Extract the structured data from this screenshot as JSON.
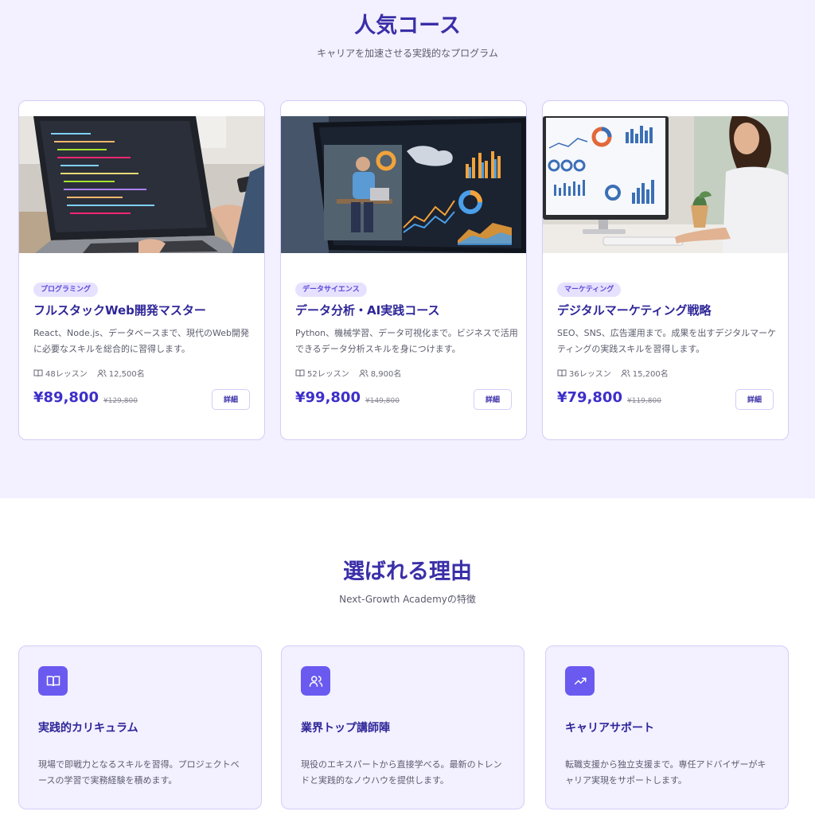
{
  "courses_section": {
    "title": "人気コース",
    "subtitle": "キャリアを加速させる実践的なプログラム",
    "courses": [
      {
        "tag": "プログラミング",
        "title": "フルスタックWeb開発マスター",
        "description": "React、Node.js、データベースまで、現代のWeb開発に必要なスキルを総合的に習得します。",
        "lessons": "48レッスン",
        "students": "12,500名",
        "price": "¥89,800",
        "old_price": "¥129,800",
        "detail_label": "詳細",
        "image_icon": "laptop-code-photo"
      },
      {
        "tag": "データサイエンス",
        "title": "データ分析・AI実践コース",
        "description": "Python、機械学習、データ可視化まで。ビジネスで活用できるデータ分析スキルを身につけます。",
        "lessons": "52レッスン",
        "students": "8,900名",
        "price": "¥99,800",
        "old_price": "¥149,800",
        "detail_label": "詳細",
        "image_icon": "data-dashboard-photo"
      },
      {
        "tag": "マーケティング",
        "title": "デジタルマーケティング戦略",
        "description": "SEO、SNS、広告運用まで。成果を出すデジタルマーケティングの実践スキルを習得します。",
        "lessons": "36レッスン",
        "students": "15,200名",
        "price": "¥79,800",
        "old_price": "¥119,800",
        "detail_label": "詳細",
        "image_icon": "marketing-monitor-photo"
      }
    ]
  },
  "reasons_section": {
    "title": "選ばれる理由",
    "subtitle": "Next-Growth Academyの特徴",
    "reasons": [
      {
        "icon": "book-icon",
        "title": "実践的カリキュラム",
        "description": "現場で即戦力となるスキルを習得。プロジェクトベースの学習で実務経験を積めます。"
      },
      {
        "icon": "users-icon",
        "title": "業界トップ講師陣",
        "description": "現役のエキスパートから直接学べる。最新のトレンドと実践的なノウハウを提供します。"
      },
      {
        "icon": "trending-up-icon",
        "title": "キャリアサポート",
        "description": "転職支援から独立支援まで。専任アドバイザーがキャリア実現をサポートします。"
      }
    ]
  },
  "colors": {
    "accent": "#6a5af0",
    "heading": "#3a2fa8",
    "section_bg": "#f3f0ff",
    "border": "#d4cdf7"
  }
}
